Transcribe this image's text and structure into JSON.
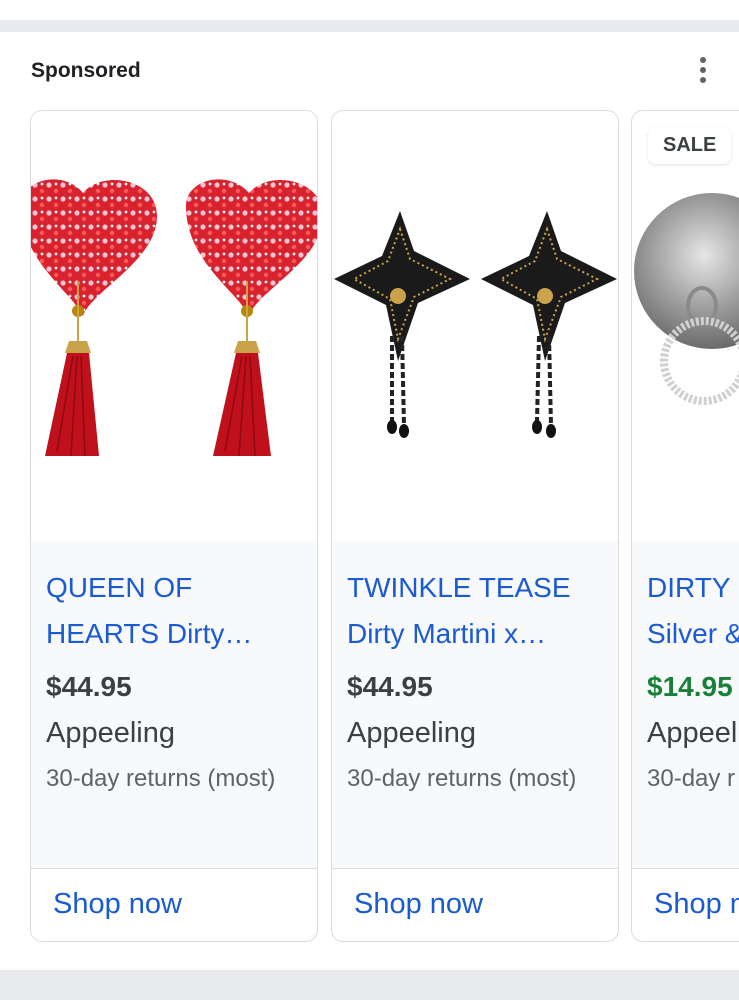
{
  "header": {
    "sponsored_label": "Sponsored",
    "menu_icon": "more-vert-icon"
  },
  "products": [
    {
      "title_line1": "QUEEN OF",
      "title_line2": "HEARTS Dirty…",
      "price": "$44.95",
      "seller": "Appeeling",
      "returns": "30-day returns (most)",
      "cta": "Shop now",
      "image_icon": "heart-tassel-pasties-image"
    },
    {
      "title_line1": "TWINKLE TEASE",
      "title_line2": "Dirty Martini x…",
      "price": "$44.95",
      "seller": "Appeeling",
      "returns": "30-day returns (most)",
      "cta": "Shop now",
      "image_icon": "star-tassel-pasties-image"
    },
    {
      "badge": "SALE",
      "title_line1": "DIRTY",
      "title_line2": "Silver &",
      "price": "$14.95",
      "seller": "Appeel",
      "returns": "30-day r",
      "cta": "Shop n",
      "image_icon": "silver-disc-pasties-image"
    }
  ],
  "colors": {
    "link": "#1a5ad2",
    "sale_price": "#188038",
    "divider": "#e8eaed"
  }
}
